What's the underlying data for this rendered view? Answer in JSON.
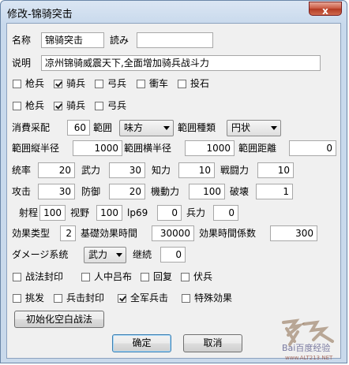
{
  "window": {
    "title": "修改-锦骑突击",
    "close_glyph": "x"
  },
  "row_name": {
    "name_label": "名称",
    "name_value": "锦骑突击",
    "reading_label": "読み",
    "reading_value": ""
  },
  "row_desc": {
    "label": "说明",
    "value": "凉州锦骑威震天下,全面增加骑兵战斗力"
  },
  "units_row1": [
    {
      "label": "枪兵",
      "checked": false
    },
    {
      "label": "骑兵",
      "checked": true
    },
    {
      "label": "弓兵",
      "checked": false
    },
    {
      "label": "衝车",
      "checked": false
    },
    {
      "label": "投石",
      "checked": false
    }
  ],
  "units_row2": [
    {
      "label": "枪兵",
      "checked": false
    },
    {
      "label": "骑兵",
      "checked": true
    },
    {
      "label": "弓兵",
      "checked": false
    }
  ],
  "cost_row": {
    "cost_label": "消費采配",
    "cost_value": "60",
    "range_label": "範囲",
    "range_value": "味方",
    "range_type_label": "範囲種類",
    "range_type_value": "円状"
  },
  "radius_row": {
    "v_label": "範囲縦半径",
    "v_value": "1000",
    "h_label": "範囲横半径",
    "h_value": "1000",
    "d_label": "範囲距離",
    "d_value": "0"
  },
  "stats_row1": [
    {
      "label": "统率",
      "value": "20"
    },
    {
      "label": "武力",
      "value": "30"
    },
    {
      "label": "知力",
      "value": "10"
    },
    {
      "label": "戦闘力",
      "value": "10"
    }
  ],
  "stats_row2": [
    {
      "label": "攻击",
      "value": "30"
    },
    {
      "label": "防御",
      "value": "20"
    },
    {
      "label": "機動力",
      "value": "100"
    },
    {
      "label": "破壊",
      "value": "1"
    }
  ],
  "stats_row3": [
    {
      "label": "射程",
      "value": "100"
    },
    {
      "label": "视野",
      "value": "100"
    },
    {
      "label": "lp69",
      "value": "0"
    },
    {
      "label": "兵力",
      "value": "0"
    }
  ],
  "effect_row": {
    "type_label": "効果类型",
    "type_value": "2",
    "base_label": "基礎効果時間",
    "base_value": "30000",
    "coef_label": "効果時間係数",
    "coef_value": "300"
  },
  "damage_row": {
    "label": "ダメージ系统",
    "value": "武力",
    "cont_label": "继続",
    "cont_value": "0"
  },
  "flags_row1": [
    {
      "label": "战法封印",
      "checked": false
    },
    {
      "label": "人中吕布",
      "checked": false
    },
    {
      "label": "回复",
      "checked": false
    },
    {
      "label": "伏兵",
      "checked": false
    }
  ],
  "flags_row2": [
    {
      "label": "挑发",
      "checked": false
    },
    {
      "label": "兵击封印",
      "checked": false
    },
    {
      "label": "全军兵击",
      "checked": true
    },
    {
      "label": "特殊効果",
      "checked": false
    }
  ],
  "buttons": {
    "init": "初始化空白战法",
    "ok": "确定",
    "cancel": "取消"
  },
  "watermark": {
    "text": "Bai百度经验",
    "url": "www.ALT213.NET"
  }
}
